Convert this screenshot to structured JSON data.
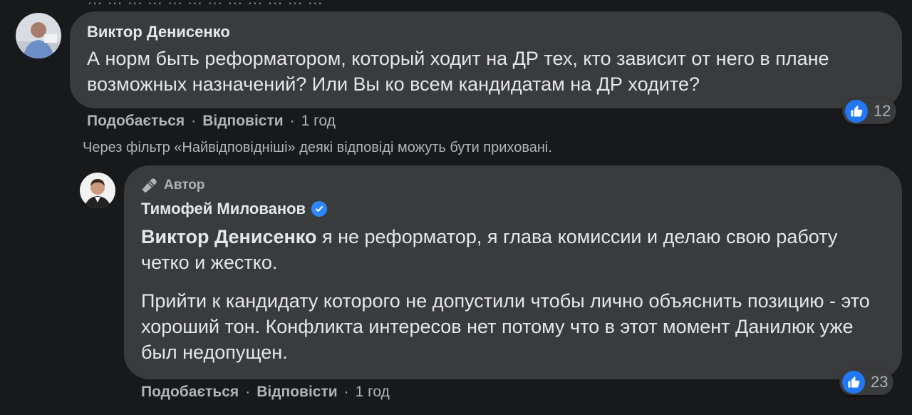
{
  "top_truncated_text": "… … … … … … … … … … … …",
  "comments": [
    {
      "author": "Виктор Денисенко",
      "text": "А норм быть реформатором, который ходит на ДР тех, кто зависит от него в плане возможных назначений? Или Вы ко всем кандидатам на ДР ходите?",
      "like_label": "Подобається",
      "reply_label": "Відповісти",
      "time": "1 год",
      "reactions": "12"
    }
  ],
  "filter_note": "Через фільтр «Найвідповідніші» деякі відповіді можуть бути приховані.",
  "reply": {
    "badge": "Автор",
    "author": "Тимофей Милованов",
    "mention": "Виктор Денисенко",
    "paragraph1_rest": " я не реформатор, я глава комиссии и делаю свою работу четко и жестко.",
    "paragraph2": "Прийти к кандидату которого не допустили чтобы лично объяснить позицию - это хороший тон. Конфликта интересов нет потому что в этот момент Данилюк уже был недопущен.",
    "like_label": "Подобається",
    "reply_label": "Відповісти",
    "time": "1 год",
    "reactions": "23"
  },
  "icons": {
    "like": "thumbs-up-icon",
    "verified": "verified-check-icon",
    "badge": "microphone-icon"
  },
  "colors": {
    "background": "#18191a",
    "bubble": "#3a3b3c",
    "text": "#e4e6eb",
    "secondary": "#b0b3b8",
    "like_blue": "#2078f4",
    "verified_blue": "#2d88ff"
  }
}
